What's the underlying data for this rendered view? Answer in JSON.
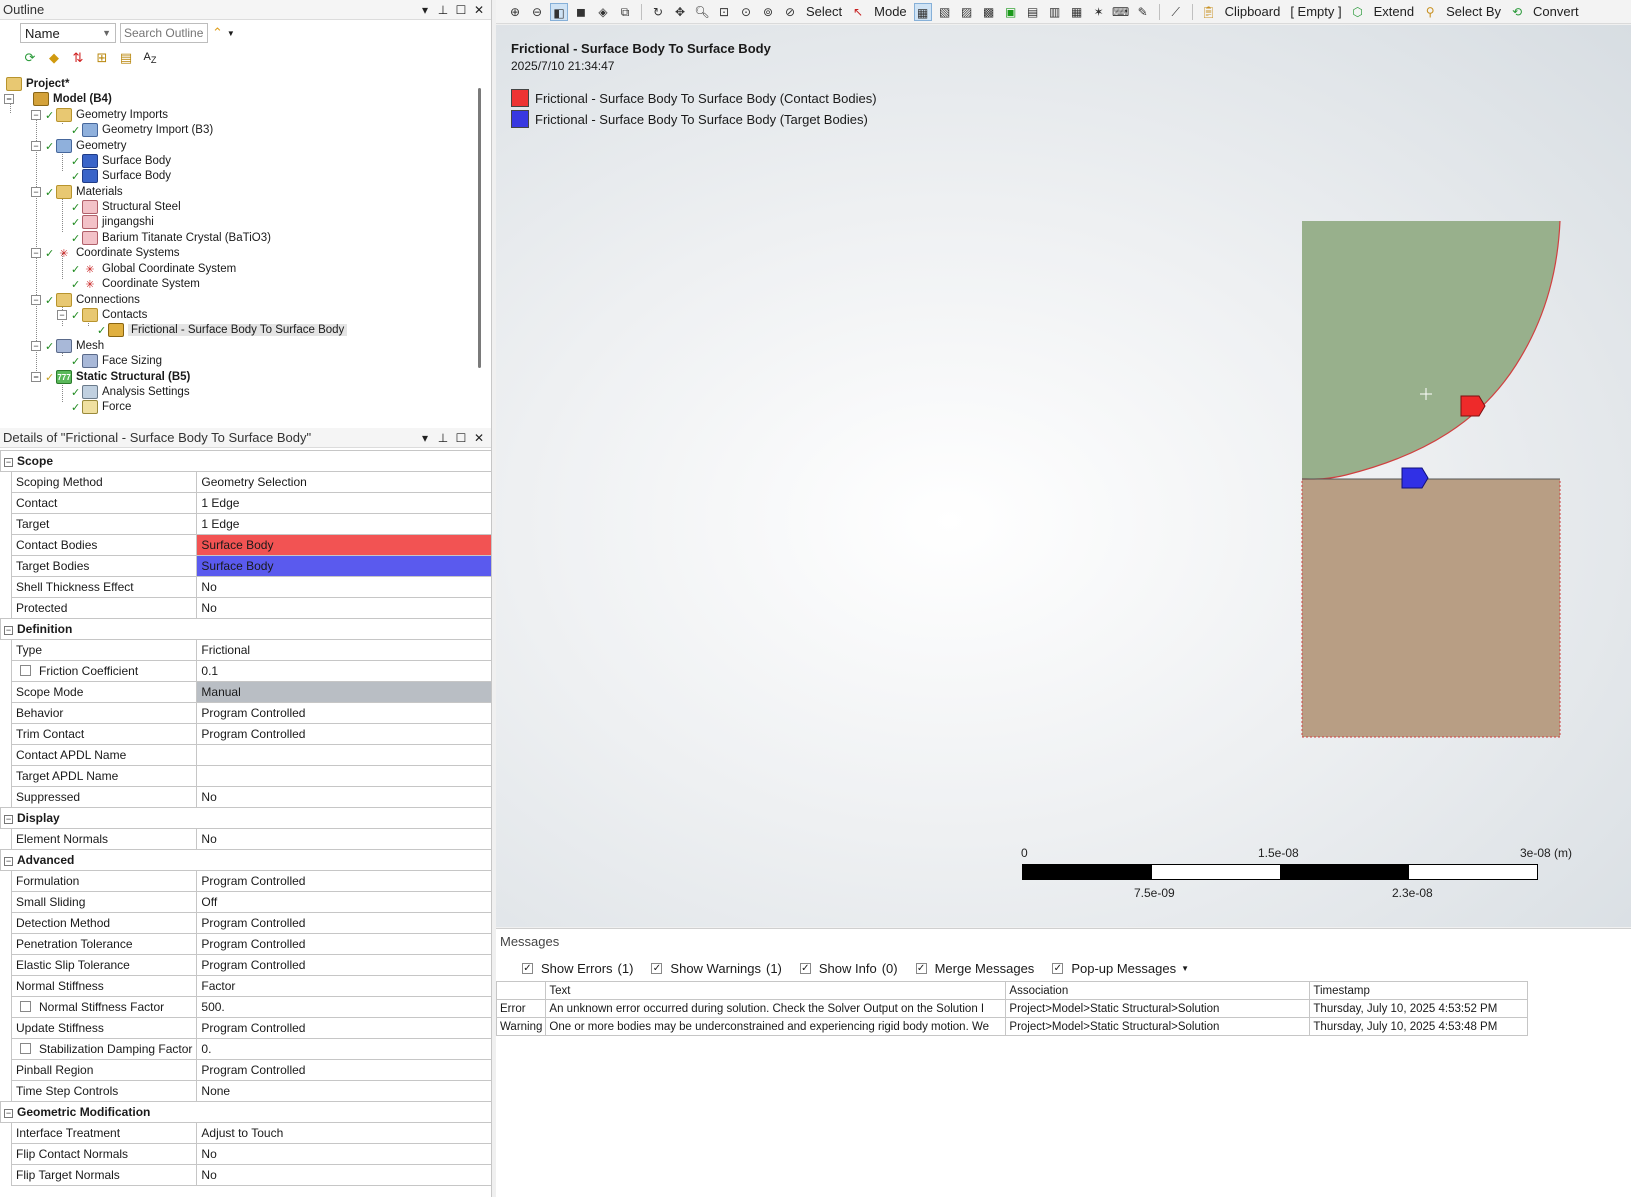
{
  "outline": {
    "title": "Outline",
    "name_filter": "Name",
    "search_placeholder": "Search Outline",
    "tree": [
      {
        "label": "Project*",
        "icon": "project-icon"
      },
      {
        "label": "Model (B4)",
        "icon": "model-icon"
      },
      {
        "label": "Geometry Imports",
        "icon": "folder-icon"
      },
      {
        "label": "Geometry Import (B3)",
        "icon": "geometry-import-icon"
      },
      {
        "label": "Geometry",
        "icon": "geometry-icon"
      },
      {
        "label": "Surface Body",
        "icon": "surface-body-icon"
      },
      {
        "label": "Surface Body",
        "icon": "surface-body-icon"
      },
      {
        "label": "Materials",
        "icon": "folder-icon"
      },
      {
        "label": "Structural Steel",
        "icon": "material-icon"
      },
      {
        "label": "jingangshi",
        "icon": "material-icon"
      },
      {
        "label": "Barium Titanate Crystal (BaTiO3)",
        "icon": "material-icon"
      },
      {
        "label": "Coordinate Systems",
        "icon": "coordinate-systems-icon"
      },
      {
        "label": "Global Coordinate System",
        "icon": "coordinate-system-icon"
      },
      {
        "label": "Coordinate System",
        "icon": "coordinate-system-icon"
      },
      {
        "label": "Connections",
        "icon": "folder-icon"
      },
      {
        "label": "Contacts",
        "icon": "folder-icon"
      },
      {
        "label": "Frictional - Surface Body To Surface Body",
        "icon": "contact-region-icon"
      },
      {
        "label": "Mesh",
        "icon": "mesh-icon"
      },
      {
        "label": "Face Sizing",
        "icon": "face-sizing-icon"
      },
      {
        "label": "Static Structural (B5)",
        "icon": "static-structural-icon"
      },
      {
        "label": "Analysis Settings",
        "icon": "analysis-settings-icon"
      },
      {
        "label": "Force",
        "icon": "force-icon"
      }
    ]
  },
  "details": {
    "title": "Details of \"Frictional - Surface Body To Surface Body\"",
    "groups": [
      {
        "name": "Scope",
        "rows": [
          {
            "k": "Scoping Method",
            "v": "Geometry Selection"
          },
          {
            "k": "Contact",
            "v": "1 Edge"
          },
          {
            "k": "Target",
            "v": "1 Edge"
          },
          {
            "k": "Contact Bodies",
            "v": "Surface Body"
          },
          {
            "k": "Target Bodies",
            "v": "Surface Body"
          },
          {
            "k": "Shell Thickness Effect",
            "v": "No"
          },
          {
            "k": "Protected",
            "v": "No"
          }
        ]
      },
      {
        "name": "Definition",
        "rows": [
          {
            "k": "Type",
            "v": "Frictional"
          },
          {
            "k": "Friction Coefficient",
            "v": "0.1"
          },
          {
            "k": "Scope Mode",
            "v": "Manual"
          },
          {
            "k": "Behavior",
            "v": "Program Controlled"
          },
          {
            "k": "Trim Contact",
            "v": "Program Controlled"
          },
          {
            "k": "Contact APDL Name",
            "v": ""
          },
          {
            "k": "Target APDL Name",
            "v": ""
          },
          {
            "k": "Suppressed",
            "v": "No"
          }
        ]
      },
      {
        "name": "Display",
        "rows": [
          {
            "k": "Element Normals",
            "v": "No"
          }
        ]
      },
      {
        "name": "Advanced",
        "rows": [
          {
            "k": "Formulation",
            "v": "Program Controlled"
          },
          {
            "k": "Small Sliding",
            "v": "Off"
          },
          {
            "k": "Detection Method",
            "v": "Program Controlled"
          },
          {
            "k": "Penetration Tolerance",
            "v": "Program Controlled"
          },
          {
            "k": "Elastic Slip Tolerance",
            "v": "Program Controlled"
          },
          {
            "k": "Normal Stiffness",
            "v": "Factor"
          },
          {
            "k": "Normal Stiffness Factor",
            "v": "500."
          },
          {
            "k": "Update Stiffness",
            "v": "Program Controlled"
          },
          {
            "k": "Stabilization Damping Factor",
            "v": "0."
          },
          {
            "k": "Pinball Region",
            "v": "Program Controlled"
          },
          {
            "k": "Time Step Controls",
            "v": "None"
          }
        ]
      },
      {
        "name": "Geometric Modification",
        "rows": [
          {
            "k": "Interface Treatment",
            "v": "Adjust to Touch"
          },
          {
            "k": "Flip Contact Normals",
            "v": "No"
          },
          {
            "k": "Flip Target Normals",
            "v": "No"
          }
        ]
      }
    ]
  },
  "toolbar": {
    "select": "Select",
    "mode": "Mode",
    "clipboard": "Clipboard",
    "empty": "[ Empty ]",
    "extend": "Extend",
    "select_by": "Select By",
    "convert": "Convert"
  },
  "viewport": {
    "title": "Frictional - Surface Body To Surface Body",
    "date": "2025/7/10 21:34:47",
    "legend": [
      {
        "label": "Frictional - Surface Body To Surface Body (Contact Bodies)",
        "color": "#ee3333"
      },
      {
        "label": "Frictional - Surface Body To Surface Body (Target Bodies)",
        "color": "#3838e0"
      }
    ],
    "colors": {
      "upper_body": "#98b08c",
      "lower_body": "#b89e84"
    },
    "scale": {
      "t0": "0",
      "t1": "1.5e-08",
      "t2": "3e-08 (m)",
      "b1": "7.5e-09",
      "b2": "2.3e-08"
    }
  },
  "messages": {
    "title": "Messages",
    "filters": {
      "errors_label": "Show Errors",
      "errors_count": "(1)",
      "warnings_label": "Show Warnings",
      "warnings_count": "(1)",
      "info_label": "Show Info",
      "info_count": "(0)",
      "merge": "Merge Messages",
      "popup": "Pop-up Messages"
    },
    "columns": [
      "Text",
      "Association",
      "Timestamp"
    ],
    "rows": [
      {
        "type": "Error",
        "text": "An unknown error occurred during solution.  Check the Solver Output on the Solution I",
        "assoc": "Project>Model>Static Structural>Solution",
        "time": "Thursday, July 10, 2025 4:53:52 PM"
      },
      {
        "type": "Warning",
        "text": "One or more bodies may be underconstrained and experiencing rigid body motion. We",
        "assoc": "Project>Model>Static Structural>Solution",
        "time": "Thursday, July 10, 2025 4:53:48 PM"
      }
    ]
  }
}
